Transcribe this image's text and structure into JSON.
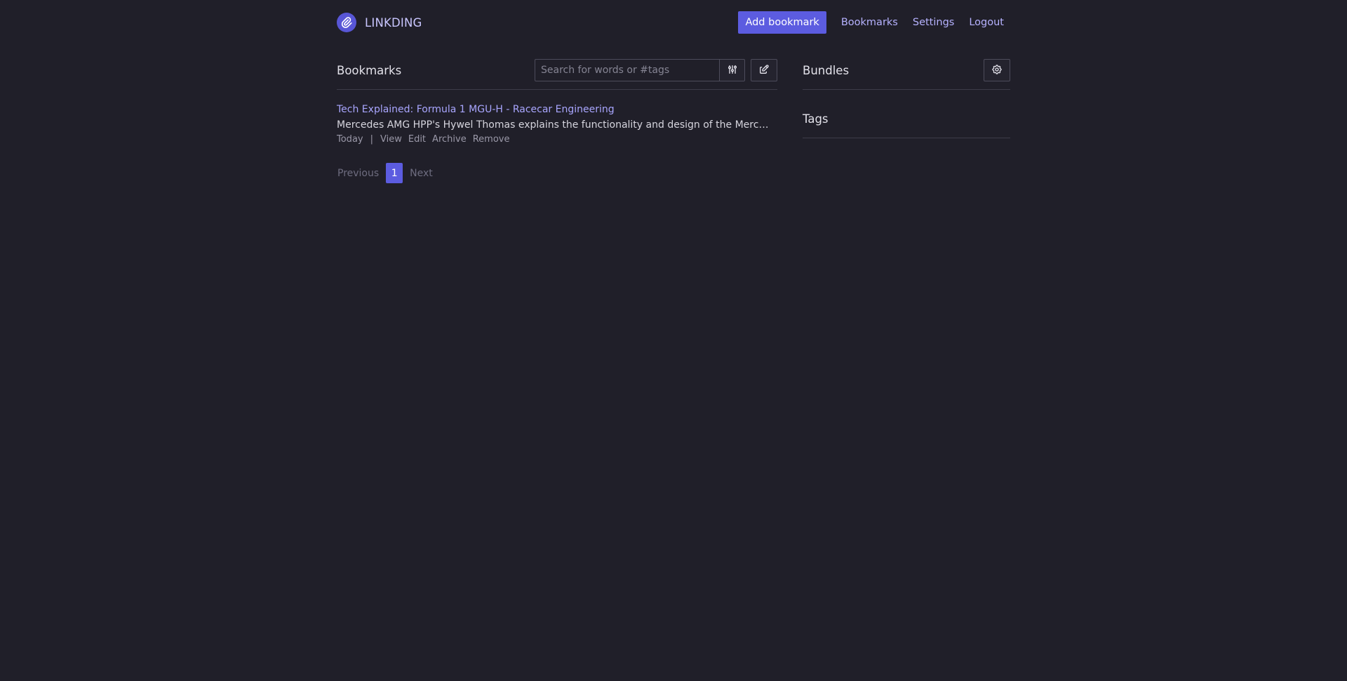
{
  "header": {
    "brand_name": "LINKDING",
    "add_bookmark_label": "Add bookmark",
    "nav": {
      "bookmarks": "Bookmarks",
      "settings": "Settings",
      "logout": "Logout"
    }
  },
  "bookmarks_section": {
    "title": "Bookmarks",
    "search_placeholder": "Search for words or #tags",
    "search_value": ""
  },
  "bookmarks": [
    {
      "title": "Tech Explained: Formula 1 MGU-H - Racecar Engineering",
      "description": "Mercedes AMG HPP's Hywel Thomas explains the functionality and design of the Mercedes W...",
      "date": "Today",
      "separator": "|",
      "actions": {
        "view": "View",
        "edit": "Edit",
        "archive": "Archive",
        "remove": "Remove"
      }
    }
  ],
  "pagination": {
    "previous": "Previous",
    "current": "1",
    "next": "Next"
  },
  "sidebar": {
    "bundles_title": "Bundles",
    "tags_title": "Tags"
  },
  "colors": {
    "background": "#201f29",
    "accent": "#5c5ce0",
    "link": "#a9a6ff"
  }
}
